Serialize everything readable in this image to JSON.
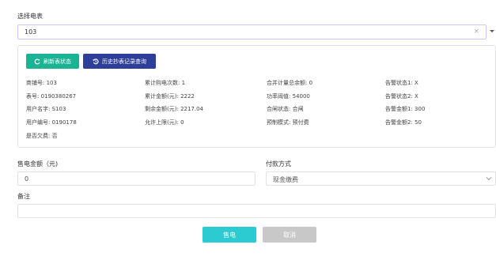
{
  "meter": {
    "label": "选择电表",
    "selected": "103",
    "clear_glyph": "×"
  },
  "buttons": {
    "refresh_label": "刷新表状态",
    "history_label": "历史抄表记录查询"
  },
  "info": {
    "col1": [
      {
        "label": "商铺号:",
        "value": "103"
      },
      {
        "label": "表号:",
        "value": "0190380267"
      },
      {
        "label": "用户名字:",
        "value": "S103"
      },
      {
        "label": "用户编号:",
        "value": "0190178"
      },
      {
        "label": "是否欠费:",
        "value": "否"
      }
    ],
    "col2": [
      {
        "label": "累计购电次数:",
        "value": "1"
      },
      {
        "label": "累计金额(元):",
        "value": "2222"
      },
      {
        "label": "剩余金额(元):",
        "value": "2217.04"
      },
      {
        "label": "允许上限(元):",
        "value": "0"
      }
    ],
    "col3": [
      {
        "label": "合并计量总余额:",
        "value": "0"
      },
      {
        "label": "功率阈值:",
        "value": "54000"
      },
      {
        "label": "合闸状态:",
        "value": "合闸"
      },
      {
        "label": "预制模式:",
        "value": "预付费"
      }
    ],
    "col4": [
      {
        "label": "告警状态1:",
        "value": "X"
      },
      {
        "label": "告警状态2:",
        "value": "X"
      },
      {
        "label": "告警金额1:",
        "value": "300"
      },
      {
        "label": "告警金额2:",
        "value": "50"
      }
    ]
  },
  "form": {
    "amount_label": "售电金额（元)",
    "amount_value": "0",
    "payment_label": "付款方式",
    "payment_value": "现金缴费",
    "remark_label": "备注",
    "remark_value": ""
  },
  "actions": {
    "sell_label": "售电",
    "cancel_label": "取消"
  },
  "colors": {
    "refresh_button": "#1ab394",
    "history_button": "#2e3f9a",
    "sell_button": "#2ccbd1",
    "cancel_button": "#c8c8c8"
  }
}
